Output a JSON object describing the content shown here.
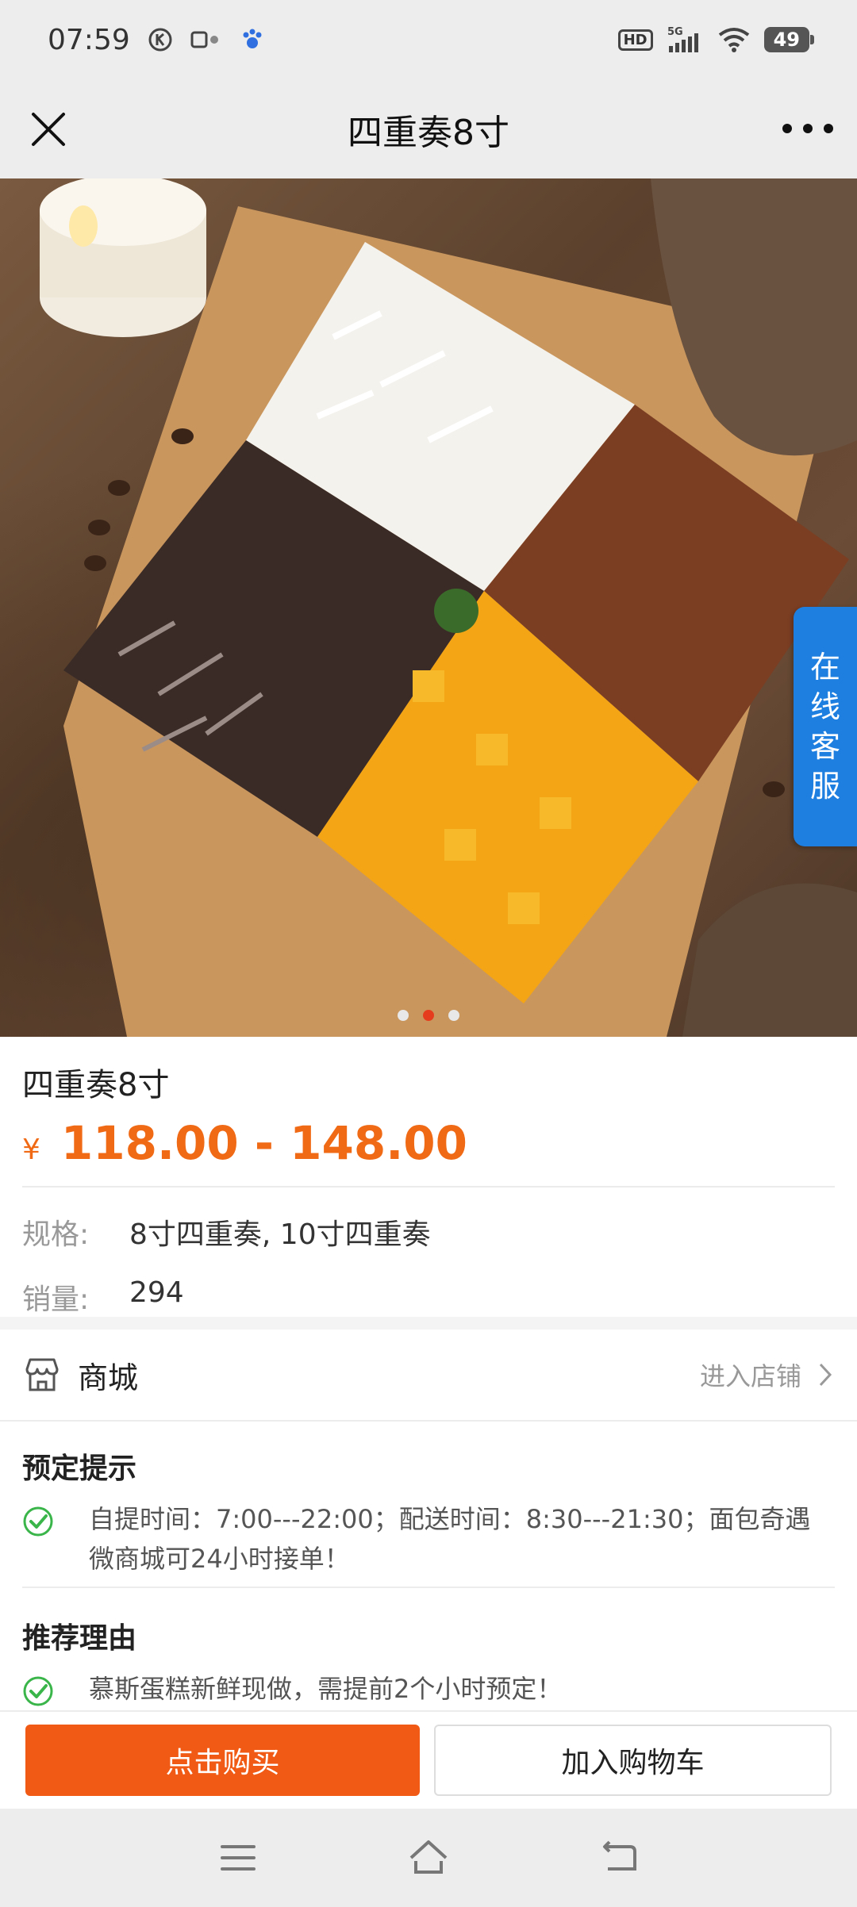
{
  "status_bar": {
    "time": "07:59",
    "left_icons": [
      "k-circle-icon",
      "sim-icon",
      "paw-app-icon"
    ],
    "network": "5G",
    "battery": "49"
  },
  "nav": {
    "title": "四重奏8寸",
    "close_icon": "close-icon",
    "more_icon": "more-icon"
  },
  "gallery": {
    "image_alt": "cake-photo",
    "dot_count": 3,
    "active_dot": 1
  },
  "customer_service": {
    "chars": [
      "在",
      "线",
      "客",
      "服"
    ]
  },
  "product": {
    "title": "四重奏8寸",
    "currency": "¥",
    "price": "118.00 - 148.00",
    "spec_label": "规格:",
    "spec_value": "8寸四重奏, 10寸四重奏",
    "sales_label": "销量:",
    "sales_value": "294"
  },
  "shop": {
    "name": "商城",
    "enter_label": "进入店铺"
  },
  "booking": {
    "title": "预定提示",
    "text_line1": "自提时间：7:00---22:00；配送时间：8:30---21:30；面包奇遇",
    "text_line2": "微商城可24小时接单！"
  },
  "recommend": {
    "title": "推荐理由",
    "text": "慕斯蛋糕新鲜现做，需提前2个小时预定！"
  },
  "actions": {
    "buy_label": "点击购买",
    "cart_label": "加入购物车"
  },
  "colors": {
    "accent": "#f06914",
    "buy_button": "#f05a14",
    "check": "#3ab54a",
    "cs_tab": "#1e7fe0"
  }
}
